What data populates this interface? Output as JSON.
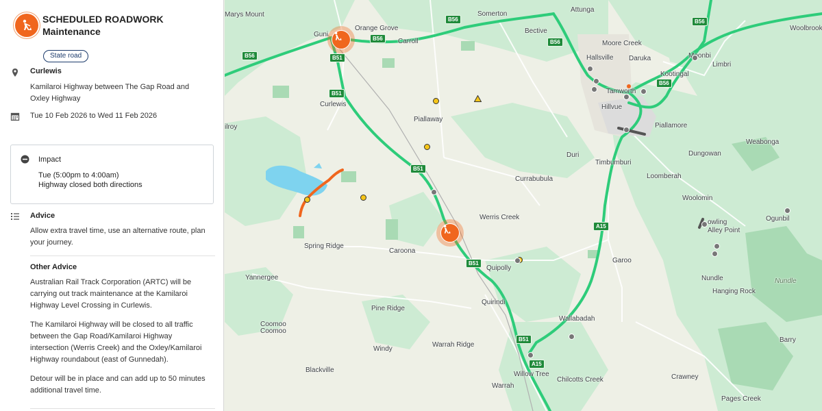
{
  "panel": {
    "title": "SCHEDULED ROADWORK",
    "subtitle": "Maintenance",
    "badge": "State road",
    "location": {
      "name": "Curlewis",
      "description": "Kamilaroi Highway between The Gap Road and Oxley Highway"
    },
    "dates": "Tue 10 Feb 2026 to Wed 11 Feb 2026",
    "impact": {
      "heading": "Impact",
      "time": "Tue (5:00pm to 4:00am)",
      "detail": "Highway closed both directions"
    },
    "advice": {
      "heading": "Advice",
      "text": "Allow extra travel time, use an alternative route, plan your journey."
    },
    "other_advice": {
      "heading": "Other Advice",
      "paragraphs": [
        "Australian Rail Track Corporation (ARTC) will be carrying out track maintenance at the Kamilaroi Highway Level Crossing in Curlewis.",
        "The Kamilaroi Highway will be closed to all traffic between the Gap Road/Kamilaroi Highway intersection (Werris Creek) and the Oxley/Kamilaroi Highway roundabout (east of Gunnedah).",
        "Detour will be in place and can add up to 50 minutes additional travel time."
      ]
    },
    "icons": {
      "header": "roadwork-icon",
      "location": "location-pin-icon",
      "dates": "calendar-icon",
      "impact": "minus-circle-icon",
      "advice": "list-icon"
    },
    "accent_color": "#f0661e",
    "badge_color": "#1b3a6b"
  },
  "map": {
    "colors": {
      "land": "#eef0e6",
      "vegetation": "#cdebd3",
      "highway": "#2ecc7a",
      "water": "#7ed3ef",
      "closure": "#f0661e"
    },
    "places": {
      "marys_mount": "Marys Mount",
      "orange_grove": "Orange Grove",
      "somerton": "Somerton",
      "attunga": "Attunga",
      "woolbrook": "Woolbrook",
      "carroll": "Carroll",
      "bective": "Bective",
      "moore_creek": "Moore Creek",
      "gunnedah": "Guni",
      "hallsville": "Hallsville",
      "daruka": "Daruka",
      "moonbi": "Moonbi",
      "limbri": "Limbri",
      "kootingal": "Kootingal",
      "tamworth": "Tamworth",
      "curlewis": "Curlewis",
      "hillvue": "Hillvue",
      "piallaway": "Piallaway",
      "piallamore": "Piallamore",
      "milroy": "ilroy",
      "weabonga": "Weabonga",
      "duri": "Duri",
      "dungowan": "Dungowan",
      "timbumburi": "Timbumburi",
      "currabubula": "Currabubula",
      "loomberah": "Loomberah",
      "woolomin": "Woolomin",
      "werris_creek": "Werris Creek",
      "ogunbil": "Ogunbil",
      "bowling_alley_point": "owling\nAlley Point",
      "spring_ridge": "Spring Ridge",
      "caroona": "Caroona",
      "garoo": "Garoo",
      "quipolly": "Quipolly",
      "yannergee": "Yannergee",
      "nundle": "Nundle",
      "nundle_forest": "Nundle",
      "hanging_rock": "Hanging Rock",
      "quirindi": "Quirindi",
      "pine_ridge": "Pine Ridge",
      "coomoo1": "Coomoo",
      "coomoo2": "Coomoo",
      "wallabadah": "Wallabadah",
      "barry": "Barry",
      "warrah_ridge": "Warrah Ridge",
      "windy": "Windy",
      "blackville": "Blackville",
      "willow_tree": "Willow Tree",
      "chilcotts_creek": "Chilcotts Creek",
      "crawney": "Crawney",
      "warrah": "Warrah",
      "pages_creek": "Pages Creek"
    },
    "shields": {
      "b56_a": "B56",
      "b56_b": "B56",
      "b56_c": "B56",
      "b56_d": "B56",
      "b56_e": "B56",
      "b56_f": "B56",
      "b51_a": "B51",
      "b51_b": "B51",
      "b51_c": "B51",
      "b51_d": "B51",
      "b51_e": "B51",
      "a15_a": "A15",
      "a15_b": "A15"
    }
  }
}
